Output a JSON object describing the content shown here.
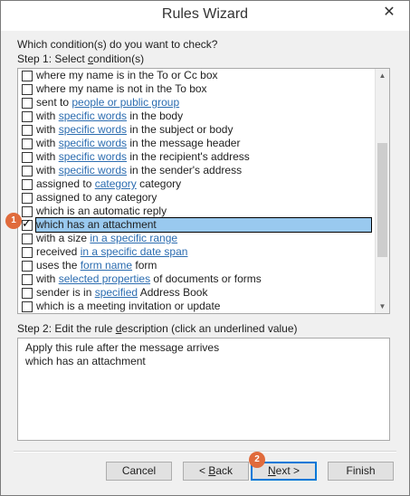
{
  "window": {
    "title": "Rules Wizard",
    "close_glyph": "✕"
  },
  "prompt": "Which condition(s) do you want to check?",
  "step1": {
    "prefix": "Step 1: Select ",
    "underline": "c",
    "suffix": "ondition(s)"
  },
  "conditions": [
    {
      "checked": false,
      "before": "where my name is in the To or Cc box",
      "link": "",
      "after": ""
    },
    {
      "checked": false,
      "before": "where my name is not in the To box",
      "link": "",
      "after": ""
    },
    {
      "checked": false,
      "before": "sent to ",
      "link": "people or public group",
      "after": ""
    },
    {
      "checked": false,
      "before": "with ",
      "link": "specific words",
      "after": " in the body"
    },
    {
      "checked": false,
      "before": "with ",
      "link": "specific words",
      "after": " in the subject or body"
    },
    {
      "checked": false,
      "before": "with ",
      "link": "specific words",
      "after": " in the message header"
    },
    {
      "checked": false,
      "before": "with ",
      "link": "specific words",
      "after": " in the recipient's address"
    },
    {
      "checked": false,
      "before": "with ",
      "link": "specific words",
      "after": " in the sender's address"
    },
    {
      "checked": false,
      "before": "assigned to ",
      "link": "category",
      "after": " category"
    },
    {
      "checked": false,
      "before": "assigned to any category",
      "link": "",
      "after": ""
    },
    {
      "checked": false,
      "before": "which is an automatic reply",
      "link": "",
      "after": ""
    },
    {
      "checked": true,
      "selected": true,
      "before": "which has an attachment",
      "link": "",
      "after": ""
    },
    {
      "checked": false,
      "before": "with a size ",
      "link": "in a specific range",
      "after": ""
    },
    {
      "checked": false,
      "before": "received ",
      "link": "in a specific date span",
      "after": ""
    },
    {
      "checked": false,
      "before": "uses the ",
      "link": "form name",
      "after": " form"
    },
    {
      "checked": false,
      "before": "with ",
      "link": "selected properties",
      "after": " of documents or forms"
    },
    {
      "checked": false,
      "before": "sender is in ",
      "link": "specified",
      "after": " Address Book"
    },
    {
      "checked": false,
      "before": "which is a meeting invitation or update",
      "link": "",
      "after": ""
    }
  ],
  "step2": {
    "prefix": "Step 2: Edit the rule ",
    "underline": "d",
    "suffix": "escription (click an underlined value)"
  },
  "description": [
    "Apply this rule after the message arrives",
    "which has an attachment"
  ],
  "buttons": {
    "cancel": "Cancel",
    "back_prefix": "< ",
    "back_underline": "B",
    "back_suffix": "ack",
    "next_underline": "N",
    "next_suffix": "ext >",
    "finish": "Finish"
  },
  "badges": {
    "one": "1",
    "two": "2"
  },
  "scroll": {
    "up_glyph": "▲",
    "down_glyph": "▼"
  }
}
